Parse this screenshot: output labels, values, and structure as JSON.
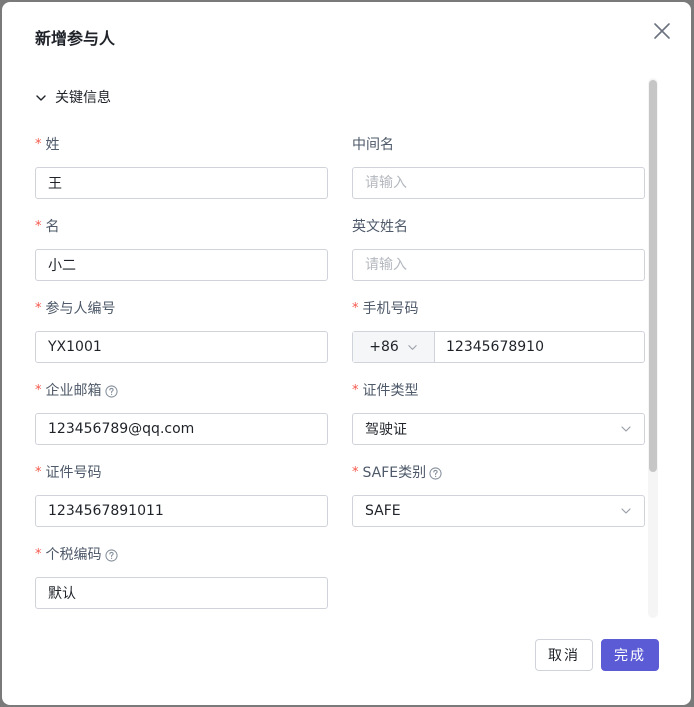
{
  "dialog": {
    "title": "新增参与人",
    "section": "关键信息"
  },
  "fields": {
    "last_name": {
      "label": "姓",
      "value": "王"
    },
    "middle_name": {
      "label": "中间名",
      "placeholder": "请输入"
    },
    "first_name": {
      "label": "名",
      "value": "小二"
    },
    "english_name": {
      "label": "英文姓名",
      "placeholder": "请输入"
    },
    "participant_id": {
      "label": "参与人编号",
      "value": "YX1001"
    },
    "phone": {
      "label": "手机号码",
      "prefix": "+86",
      "value": "12345678910"
    },
    "email": {
      "label": "企业邮箱",
      "value": "123456789@qq.com"
    },
    "id_type": {
      "label": "证件类型",
      "value": "驾驶证"
    },
    "id_number": {
      "label": "证件号码",
      "value": "1234567891011"
    },
    "safe_type": {
      "label": "SAFE类别",
      "value": "SAFE"
    },
    "tax_code": {
      "label": "个税编码",
      "value": "默认"
    }
  },
  "footer": {
    "cancel_label": "取消",
    "ok_label": "完成"
  },
  "colors": {
    "primary": "#5b5bd6",
    "required": "#f5574a",
    "border": "#d0d3d9"
  }
}
